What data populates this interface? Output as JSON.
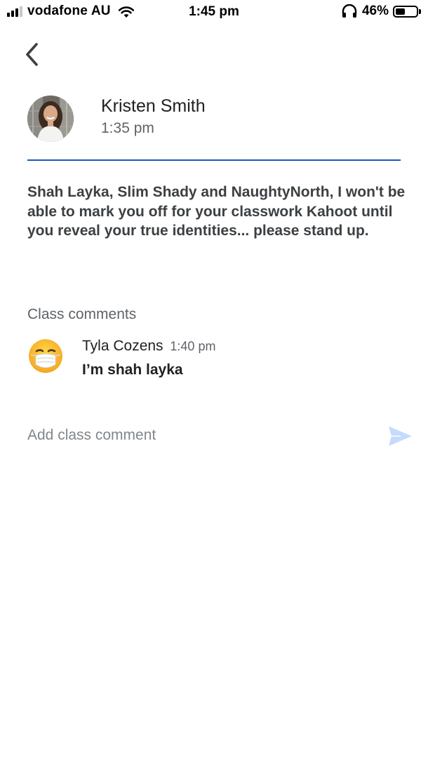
{
  "status_bar": {
    "carrier": "vodafone AU",
    "time": "1:45 pm",
    "battery_percent": "46%",
    "battery_level": 0.46,
    "signal_bars": 3
  },
  "post": {
    "author": "Kristen Smith",
    "time": "1:35 pm",
    "body": "Shah Layka, Slim Shady and NaughtyNorth, I won't be able to mark you off for your classwork Kahoot until you reveal your true identities... please stand up."
  },
  "comments": {
    "title": "Class comments",
    "items": [
      {
        "author": "Tyla Cozens",
        "time": "1:40 pm",
        "text": "I’m shah layka",
        "avatar_icon": "face-with-medical-mask-icon"
      }
    ]
  },
  "composer": {
    "placeholder": "Add class comment",
    "send_icon": "send-icon"
  },
  "colors": {
    "divider": "#1a57c4",
    "send_icon": "#c6dafc"
  }
}
